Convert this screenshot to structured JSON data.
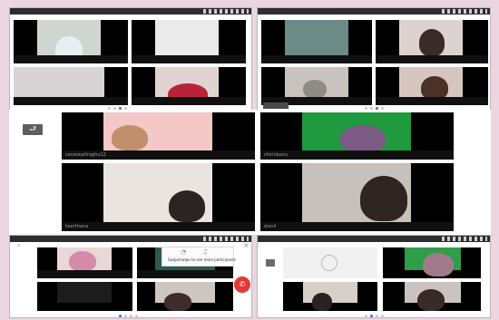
{
  "screens": {
    "top_left": {
      "tiles": [
        {
          "name": ""
        },
        {
          "name": ""
        },
        {
          "name": ""
        },
        {
          "name": ""
        }
      ],
      "pager": {
        "total": 4,
        "active": 3
      }
    },
    "top_right": {
      "tiles": [
        {
          "name": ""
        },
        {
          "name": ""
        },
        {
          "name": ""
        },
        {
          "name": ""
        }
      ],
      "pager": {
        "total": 4,
        "active": 3
      }
    },
    "middle": {
      "back_icon": "⮐",
      "tiles": [
        {
          "name": "saraswatiraghu12"
        },
        {
          "name": "shirinbanu"
        },
        {
          "name": "keerthana"
        },
        {
          "name": "elavil"
        }
      ]
    },
    "bottom_left": {
      "popup_hint": "Swipe/swipe to see more participants",
      "end_call_icon": "✆",
      "pager": {
        "total": 4,
        "active": 1
      }
    },
    "bottom_right": {
      "pager": {
        "total": 4,
        "active": 2
      }
    }
  },
  "colors": {
    "background": "#ead6e0",
    "tile_bg": "#000000",
    "pager_active": "#3b6fd1",
    "end_call": "#e53935"
  }
}
